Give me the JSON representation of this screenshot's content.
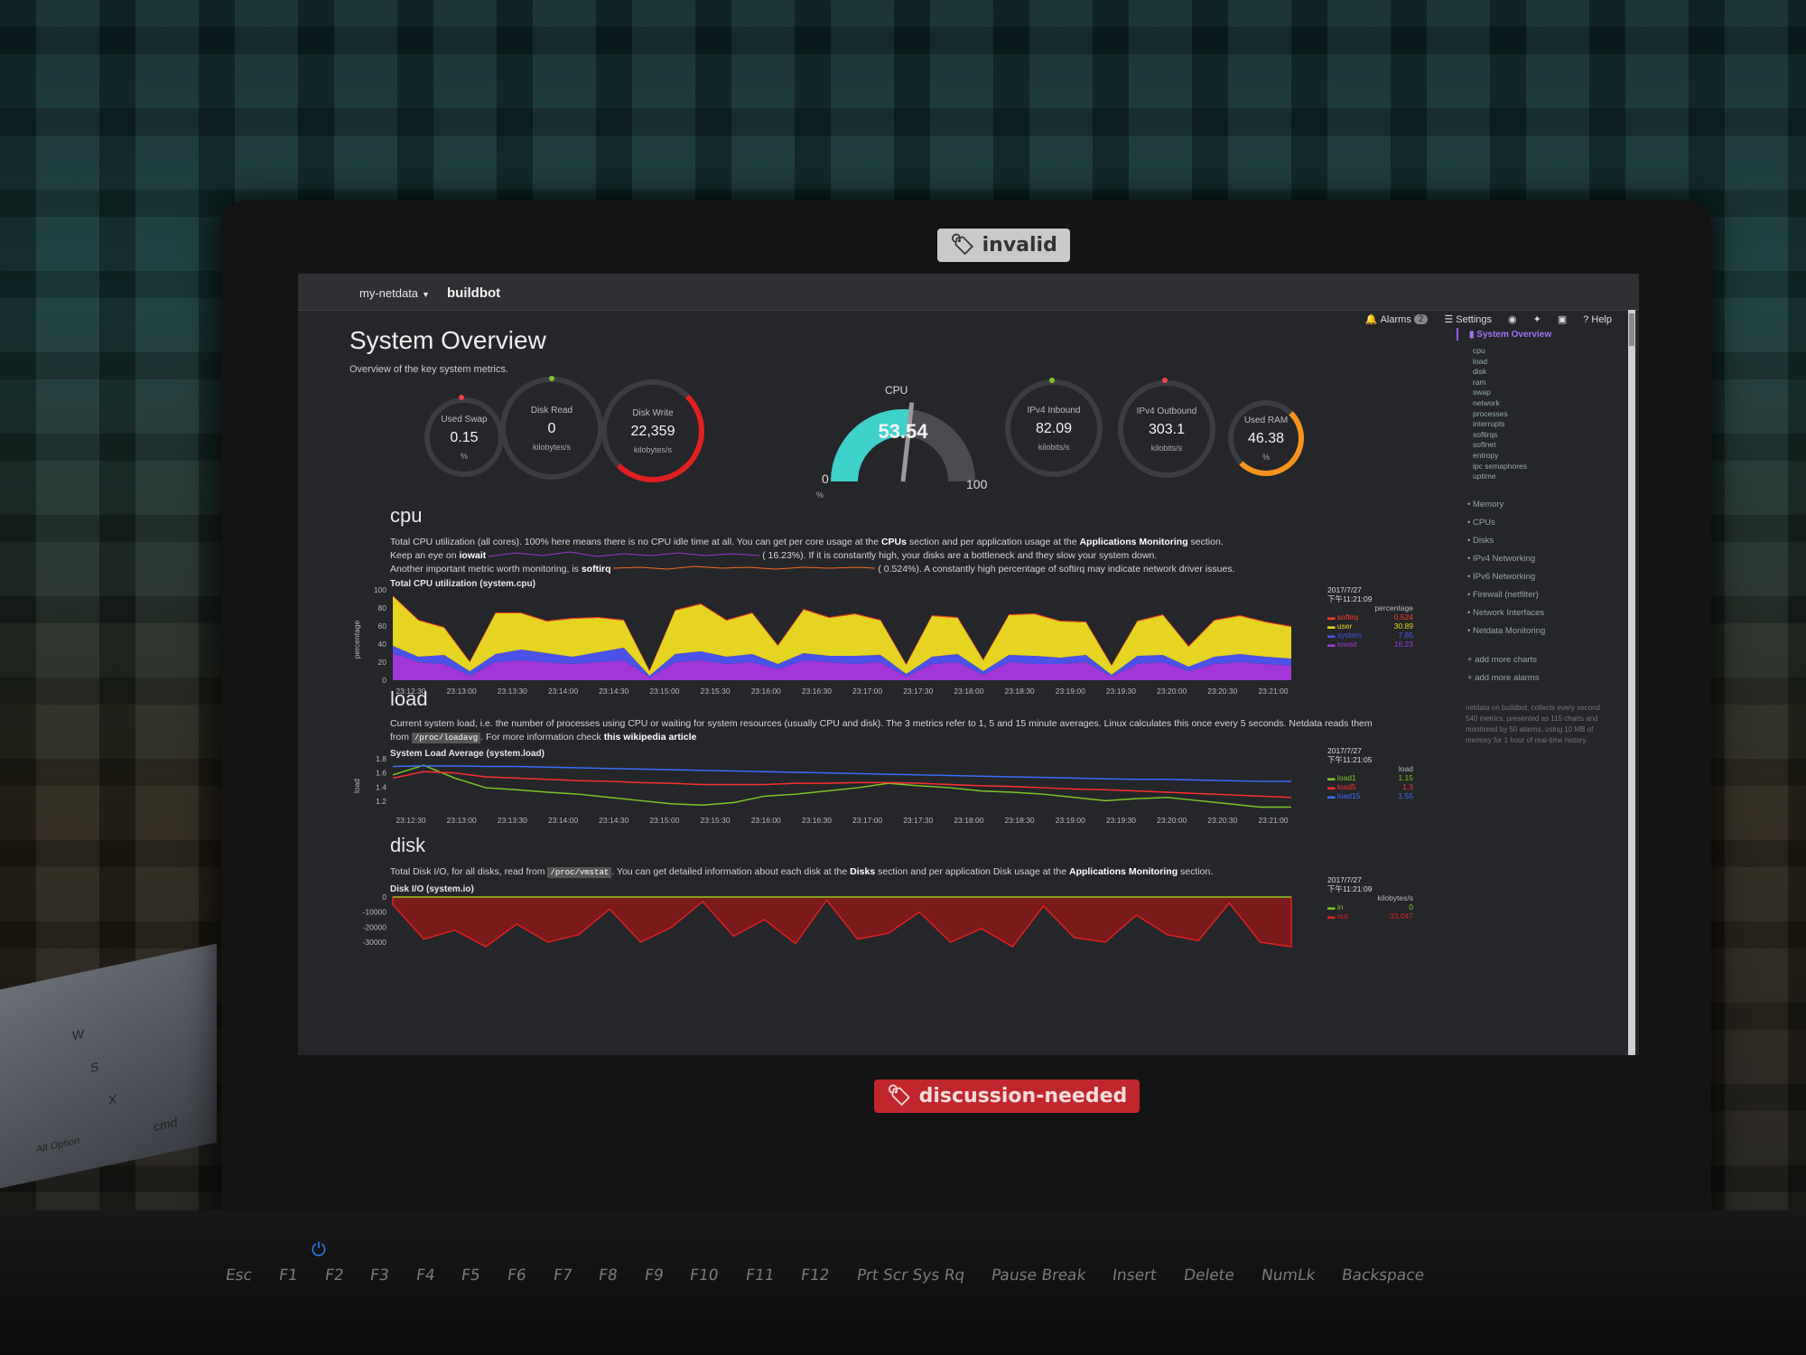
{
  "stickers": {
    "top": "invalid",
    "bottom": "discussion-needed"
  },
  "navbar": {
    "brand": "my-netdata",
    "host": "buildbot",
    "alarms_label": "Alarms",
    "alarms_count": "2",
    "settings_label": "Settings",
    "help_label": "Help"
  },
  "page": {
    "title": "System Overview",
    "subtitle": "Overview of the key system metrics."
  },
  "gauges": {
    "swap": {
      "label": "Used Swap",
      "value": "0.15",
      "unit": "%"
    },
    "disk_read": {
      "label": "Disk Read",
      "value": "0",
      "unit": "kilobytes/s"
    },
    "disk_write": {
      "label": "Disk Write",
      "value": "22,359",
      "unit": "kilobytes/s"
    },
    "cpu": {
      "title": "CPU",
      "value": "53.54",
      "min": "0",
      "max": "100",
      "unit": "%",
      "fraction": 0.5354
    },
    "ipv4_in": {
      "label": "IPv4 Inbound",
      "value": "82.09",
      "unit": "kilobits/s"
    },
    "ipv4_out": {
      "label": "IPv4 Outbound",
      "value": "303.1",
      "unit": "kilobits/s"
    },
    "ram": {
      "label": "Used RAM",
      "value": "46.38",
      "unit": "%"
    }
  },
  "sections": {
    "cpu": {
      "heading": "cpu",
      "line1_a": "Total CPU utilization (all cores). 100% here means there is no CPU idle time at all. You can get per core usage at the ",
      "line1_b": "CPUs",
      "line1_c": " section and per application usage at the ",
      "line1_d": "Applications Monitoring",
      "line1_e": " section.",
      "line2_a": "Keep an eye on ",
      "line2_b": "iowait",
      "line2_c": "16.23%). If it is constantly high, your disks are a bottleneck and they slow your system down.",
      "line3_a": "Another important metric worth monitoring, is ",
      "line3_b": "softirq",
      "line3_c": "0.524%). A constantly high percentage of softirq may indicate network driver issues.",
      "chart_title": "Total CPU utilization (system.cpu)",
      "ylabel": "percentage",
      "legend_date": "2017/7/27",
      "legend_time": "下午11:21:09",
      "legend_unit": "percentage"
    },
    "load": {
      "heading": "load",
      "line1": "Current system load, i.e. the number of processes using CPU or waiting for system resources (usually CPU and disk). The 3 metrics refer to 1, 5 and 15 minute averages. Linux calculates this once every 5 seconds. Netdata reads them",
      "line2_a": "from ",
      "line2_code": "/proc/loadavg",
      "line2_b": ". For more information check ",
      "line2_link": "this wikipedia article",
      "chart_title": "System Load Average (system.load)",
      "ylabel": "load",
      "legend_date": "2017/7/27",
      "legend_time": "下午11:21:05",
      "legend_unit": "load"
    },
    "disk": {
      "heading": "disk",
      "line1_a": "Total Disk I/O, for all disks, read from ",
      "line1_code": "/proc/vmstat",
      "line1_b": ". You can get detailed information about each disk at the ",
      "line1_c": "Disks",
      "line1_d": " section and per application Disk usage at the ",
      "line1_e": "Applications Monitoring",
      "line1_f": " section.",
      "chart_title": "Disk I/O (system.io)",
      "legend_date": "2017/7/27",
      "legend_time": "下午11:21:09",
      "legend_unit": "kilobytes/s"
    }
  },
  "chart_data": [
    {
      "type": "area",
      "title": "Total CPU utilization (system.cpu)",
      "ylabel": "percentage",
      "ylim": [
        0,
        100
      ],
      "yticks": [
        "100",
        "80",
        "60",
        "40",
        "20",
        "0"
      ],
      "x_ticks": [
        "23:12:30",
        "23:13:00",
        "23:13:30",
        "23:14:00",
        "23:14:30",
        "23:15:00",
        "23:15:30",
        "23:16:00",
        "23:16:30",
        "23:17:00",
        "23:17:30",
        "23:18:00",
        "23:18:30",
        "23:19:00",
        "23:19:30",
        "23:20:00",
        "23:20:30",
        "23:21:00"
      ],
      "series": [
        {
          "name": "softirq",
          "color": "#ff3b1f",
          "last": "0.524",
          "values": [
            1,
            1,
            1,
            1,
            1,
            1,
            1,
            1,
            1,
            1,
            1,
            1,
            1,
            1,
            1,
            1,
            1,
            1,
            1,
            1,
            1,
            1,
            1,
            1,
            1,
            1,
            1,
            1,
            1,
            1,
            1,
            1,
            1,
            1,
            1,
            1
          ]
        },
        {
          "name": "user",
          "color": "#e5d422",
          "last": "30.89",
          "values": [
            55,
            40,
            30,
            10,
            45,
            40,
            35,
            42,
            38,
            30,
            5,
            48,
            52,
            40,
            45,
            20,
            48,
            42,
            46,
            38,
            10,
            45,
            40,
            12,
            44,
            46,
            40,
            36,
            10,
            38,
            44,
            22,
            40,
            42,
            38,
            35
          ]
        },
        {
          "name": "system",
          "color": "#4a52e8",
          "last": "7.85",
          "values": [
            8,
            6,
            10,
            5,
            9,
            12,
            10,
            8,
            11,
            14,
            2,
            9,
            10,
            8,
            9,
            6,
            8,
            7,
            9,
            8,
            3,
            8,
            9,
            4,
            8,
            9,
            7,
            8,
            2,
            9,
            8,
            5,
            8,
            9,
            8,
            8
          ]
        },
        {
          "name": "iowait",
          "color": "#a037d6",
          "last": "16.23",
          "values": [
            30,
            20,
            18,
            5,
            20,
            22,
            20,
            18,
            20,
            22,
            3,
            20,
            22,
            18,
            20,
            12,
            22,
            20,
            18,
            20,
            4,
            18,
            20,
            6,
            20,
            18,
            18,
            20,
            4,
            18,
            20,
            10,
            18,
            20,
            18,
            16
          ]
        }
      ]
    },
    {
      "type": "line",
      "title": "System Load Average (system.load)",
      "ylabel": "load",
      "ylim": [
        1.1,
        1.9
      ],
      "yticks": [
        "1.8",
        "1.6",
        "1.4",
        "1.2"
      ],
      "x_ticks": [
        "23:12:30",
        "23:13:00",
        "23:13:30",
        "23:14:00",
        "23:14:30",
        "23:15:00",
        "23:15:30",
        "23:16:00",
        "23:16:30",
        "23:17:00",
        "23:17:30",
        "23:18:00",
        "23:18:30",
        "23:19:00",
        "23:19:30",
        "23:20:00",
        "23:20:30",
        "23:21:00"
      ],
      "series": [
        {
          "name": "load1",
          "color": "#7ec622",
          "last": "1.15",
          "values": [
            1.65,
            1.8,
            1.6,
            1.45,
            1.42,
            1.38,
            1.35,
            1.3,
            1.25,
            1.2,
            1.18,
            1.22,
            1.32,
            1.35,
            1.4,
            1.45,
            1.52,
            1.48,
            1.45,
            1.4,
            1.38,
            1.35,
            1.3,
            1.25,
            1.28,
            1.3,
            1.25,
            1.2,
            1.15,
            1.15
          ]
        },
        {
          "name": "load5",
          "color": "#ff2e2e",
          "last": "1.3",
          "values": [
            1.6,
            1.7,
            1.68,
            1.62,
            1.6,
            1.58,
            1.56,
            1.55,
            1.53,
            1.52,
            1.5,
            1.5,
            1.5,
            1.52,
            1.52,
            1.53,
            1.53,
            1.52,
            1.5,
            1.48,
            1.47,
            1.45,
            1.43,
            1.42,
            1.4,
            1.38,
            1.36,
            1.34,
            1.32,
            1.3
          ]
        },
        {
          "name": "load15",
          "color": "#3a6dff",
          "last": "1.55",
          "values": [
            1.78,
            1.79,
            1.79,
            1.78,
            1.78,
            1.77,
            1.76,
            1.75,
            1.74,
            1.73,
            1.72,
            1.71,
            1.7,
            1.69,
            1.68,
            1.67,
            1.66,
            1.65,
            1.64,
            1.63,
            1.62,
            1.61,
            1.6,
            1.59,
            1.58,
            1.58,
            1.57,
            1.56,
            1.55,
            1.55
          ]
        }
      ]
    },
    {
      "type": "area",
      "title": "Disk I/O (system.io)",
      "yticks": [
        "0",
        "-10000",
        "-20000",
        "-30000"
      ],
      "ylim": [
        -35000,
        1000
      ],
      "series": [
        {
          "name": "in",
          "color": "#7ec622",
          "last": "0",
          "values": [
            0,
            0,
            0,
            0,
            0,
            0,
            0,
            0,
            0,
            0,
            0,
            0,
            0,
            0,
            0,
            0,
            0,
            0,
            0,
            0,
            0,
            0,
            0,
            0,
            0,
            0,
            0,
            0,
            0,
            0
          ]
        },
        {
          "name": "out",
          "color": "#e02020",
          "last": "-33,047",
          "values": [
            -5000,
            -28000,
            -22000,
            -33000,
            -18000,
            -30000,
            -25000,
            -8000,
            -30000,
            -20000,
            -3000,
            -26000,
            -15000,
            -31000,
            -2000,
            -28000,
            -24000,
            -10000,
            -30000,
            -21000,
            -33000,
            -6000,
            -27000,
            -30000,
            -12000,
            -25000,
            -29000,
            -4000,
            -30000,
            -33047
          ]
        }
      ]
    }
  ],
  "sidebar": {
    "active": "System Overview",
    "sub": [
      "cpu",
      "load",
      "disk",
      "ram",
      "swap",
      "network",
      "processes",
      "interrupts",
      "softirqs",
      "softnet",
      "entropy",
      "ipc semaphores",
      "uptime"
    ],
    "items": [
      "Memory",
      "CPUs",
      "Disks",
      "IPv4 Networking",
      "IPv6 Networking",
      "Firewall (netfilter)",
      "Network Interfaces",
      "Netdata Monitoring"
    ],
    "add_charts": "add more charts",
    "add_alarms": "add more alarms",
    "note": "netdata on buildbot, collects every second 540 metrics, presented as 115 charts and monitored by 50 alarms, using 10 MB of memory for 1 hour of real-time history."
  },
  "keyboard": {
    "keys": [
      "Esc",
      "F1",
      "F2",
      "F3",
      "F4",
      "F5",
      "F6",
      "F7",
      "F8",
      "F9",
      "F10",
      "F11",
      "F12",
      "Prt Scr Sys Rq",
      "Pause Break",
      "Insert",
      "Delete",
      "NumLk",
      "Backspace"
    ],
    "left_keys": [
      "W",
      "S",
      "X",
      "Alt Option",
      "cmd"
    ]
  }
}
